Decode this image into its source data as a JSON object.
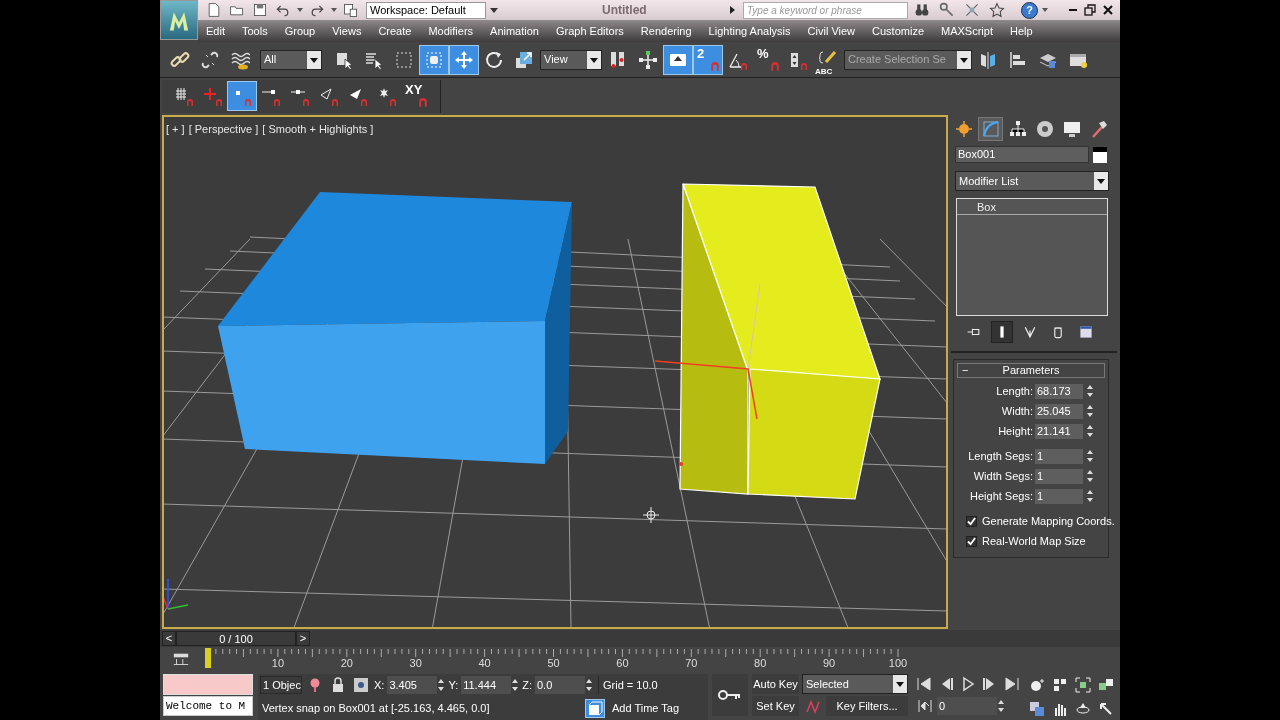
{
  "title_bar": {
    "workspace": "Workspace: Default",
    "document_title": "Untitled",
    "search": {
      "placeholder": "Type a keyword or phrase"
    },
    "help_label": "?"
  },
  "menu": [
    "Edit",
    "Tools",
    "Group",
    "Views",
    "Create",
    "Modifiers",
    "Animation",
    "Graph Editors",
    "Rendering",
    "Lighting Analysis",
    "Civil View",
    "Customize",
    "MAXScript",
    "Help"
  ],
  "main_toolbar": {
    "selection_filter": "All",
    "reference_coordinate_system": "View",
    "named_selection": {
      "placeholder": "Create Selection Se"
    },
    "buttons": [
      {
        "active": false
      },
      {
        "active": false
      },
      {
        "active": false
      },
      {
        "active": false
      },
      {
        "active": false
      },
      {
        "active": false
      },
      {
        "active": true
      },
      {
        "active": true
      },
      {
        "active": false
      },
      {
        "active": false
      },
      {
        "active": false
      },
      {
        "active": false
      },
      {
        "active": true
      },
      {
        "active": true,
        "label": "2"
      },
      {
        "active": false
      },
      {
        "active": false,
        "label": "%"
      },
      {
        "active": false
      },
      {
        "active": false,
        "label": "ABC"
      },
      {
        "active": false
      },
      {
        "active": false
      },
      {
        "active": false
      },
      {
        "active": false
      }
    ]
  },
  "snaps_toolbar": {
    "buttons": [
      {
        "active": false
      },
      {
        "active": false
      },
      {
        "active": true
      },
      {
        "active": false
      },
      {
        "active": false
      },
      {
        "active": false
      },
      {
        "active": false
      },
      {
        "active": false
      },
      {
        "active": false,
        "label": "XY"
      }
    ]
  },
  "viewport": {
    "labels": [
      "[ + ]",
      "[ Perspective ]",
      "[ Smooth + Highlights ]"
    ]
  },
  "command_panel": {
    "tabs": [
      {
        "selected": false
      },
      {
        "selected": true
      },
      {
        "selected": false
      },
      {
        "selected": false
      },
      {
        "selected": false
      },
      {
        "selected": false
      }
    ],
    "object_name": "Box001",
    "modifier_list": "Modifier List",
    "stack": [
      {
        "label": "Box",
        "selected": false
      }
    ],
    "stack_buttons": [
      {
        "active": false
      },
      {
        "active": true
      },
      {
        "active": false
      },
      {
        "active": false
      },
      {
        "active": false
      }
    ],
    "rollout": {
      "toggle": "−",
      "title": "Parameters",
      "spinners": [
        {
          "label": "Length:",
          "value": "68.173"
        },
        {
          "label": "Width:",
          "value": "25.045"
        },
        {
          "label": "Height:",
          "value": "21.141"
        },
        {
          "label": "Length Segs:",
          "value": "1"
        },
        {
          "label": "Width Segs:",
          "value": "1"
        },
        {
          "label": "Height Segs:",
          "value": "1"
        }
      ],
      "checkboxes": [
        {
          "label": "Generate Mapping Coords.",
          "checked": true
        },
        {
          "label": "Real-World Map Size",
          "checked": true
        }
      ]
    }
  },
  "timeline": {
    "prev": "<",
    "position": "0 / 100",
    "next": ">",
    "level": 0,
    "ticks": [
      "10",
      "20",
      "30",
      "40",
      "50",
      "60",
      "70",
      "80",
      "90",
      "100"
    ]
  },
  "status_bar": {
    "listener_output": "Welcome to M",
    "selection_count": "1 Objec",
    "coords": [
      {
        "axis": "X:",
        "value": "3.405"
      },
      {
        "axis": "Y:",
        "value": "11.444"
      },
      {
        "axis": "Z:",
        "value": "0.0"
      }
    ],
    "grid": "Grid = 10.0",
    "prompt": "Vertex snap on Box001 at [-25.163, 4.465, 0.0]",
    "add_time_tag": "Add Time Tag"
  },
  "animation_controls": {
    "auto_key": "Auto Key",
    "auto_key_on": false,
    "set_key": "Set Key",
    "key_mode": "Selected",
    "key_filters": "Key Filters...",
    "current_frame": "0"
  }
}
